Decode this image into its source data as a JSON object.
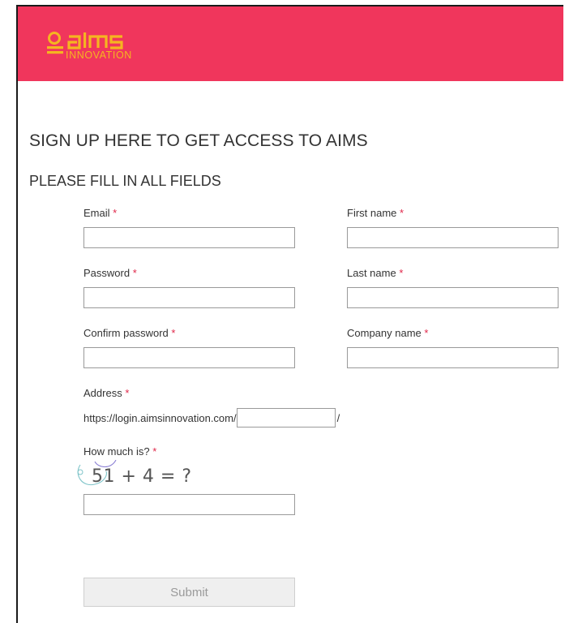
{
  "colors": {
    "brand_bg": "#f0365c",
    "logo_accent": "#f5b520",
    "required_star": "#e0284a"
  },
  "logo": {
    "name": "aims",
    "subtitle": "INNOVATION"
  },
  "headings": {
    "main": "SIGN UP HERE TO GET ACCESS TO AIMS",
    "sub": "PLEASE FILL IN ALL FIELDS"
  },
  "required_marker": "*",
  "fields": {
    "email": {
      "label": "Email",
      "value": ""
    },
    "first_name": {
      "label": "First name",
      "value": ""
    },
    "password": {
      "label": "Password",
      "value": ""
    },
    "last_name": {
      "label": "Last name",
      "value": ""
    },
    "confirm_password": {
      "label": "Confirm password",
      "value": ""
    },
    "company_name": {
      "label": "Company name",
      "value": ""
    },
    "address": {
      "label": "Address",
      "prefix": "https://login.aimsinnovation.com/",
      "suffix": "/",
      "value": ""
    },
    "captcha": {
      "label": "How much is?",
      "question": "51 + 4 = ?",
      "value": ""
    }
  },
  "submit": {
    "label": "Submit"
  }
}
